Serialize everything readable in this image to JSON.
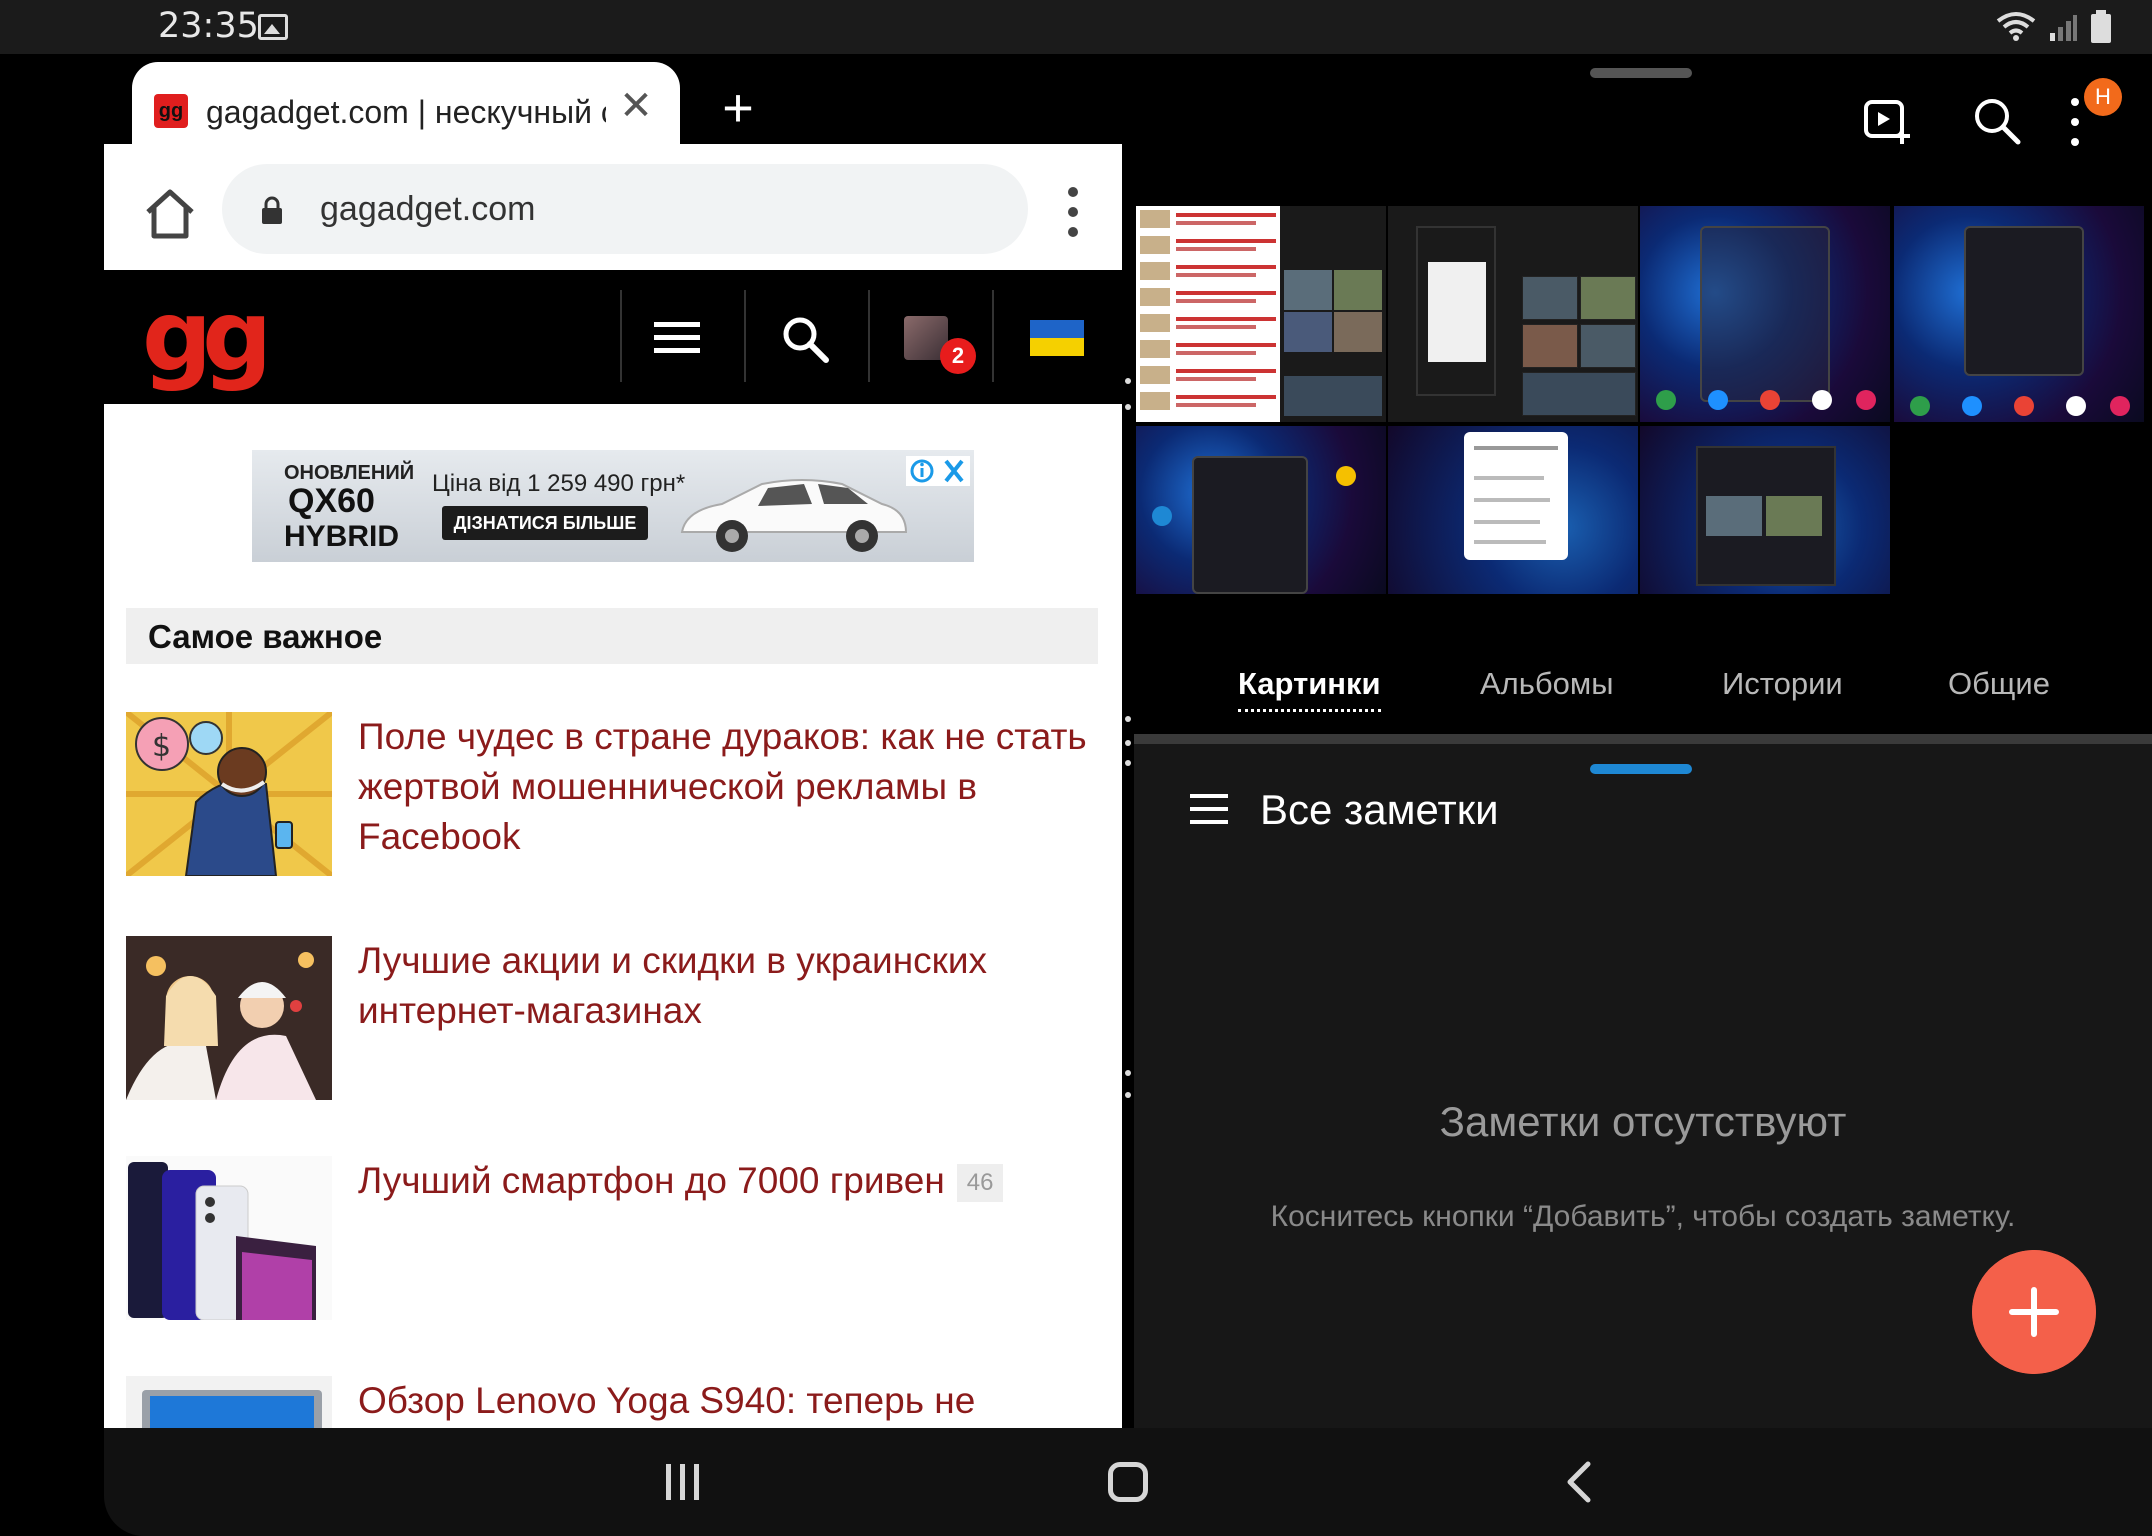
{
  "status_bar": {
    "time": "23:35"
  },
  "browser": {
    "tab_title": "gagadget.com | нескучный с",
    "url": "gagadget.com",
    "site_logo": "gg",
    "notifications_count": "2",
    "ad": {
      "line1": "ОНОВЛЕНИЙ",
      "line2": "QX60",
      "line3": "HYBRID",
      "price": "Ціна від 1 259 490 грн*",
      "cta": "ДІЗНАТИСЯ БІЛЬШЕ"
    },
    "section_title": "Самое важное",
    "articles": [
      {
        "title": "Поле чудес в стране дураков: как не стать жертвой мошеннической рекламы в Facebook",
        "comments": ""
      },
      {
        "title": "Лучшие акции и скидки в украинских интернет-магазинах",
        "comments": ""
      },
      {
        "title": "Лучший смартфон до 7000 гривен",
        "comments": "46"
      },
      {
        "title": "Обзор Lenovo Yoga S940: теперь не",
        "comments": ""
      }
    ]
  },
  "gallery": {
    "profile_badge": "H",
    "tabs": [
      {
        "label": "Картинки",
        "active": true
      },
      {
        "label": "Альбомы",
        "active": false
      },
      {
        "label": "Истории",
        "active": false
      },
      {
        "label": "Общие",
        "active": false
      }
    ]
  },
  "notes": {
    "title": "Все заметки",
    "empty_title": "Заметки отсутствуют",
    "empty_hint": "Коснитесь кнопки “Добавить”, чтобы создать заметку."
  },
  "colors": {
    "accent_red": "#8b1b1b",
    "logo_red": "#e1251b",
    "fab": "#f4604a",
    "notes_handle": "#1e88d4"
  }
}
